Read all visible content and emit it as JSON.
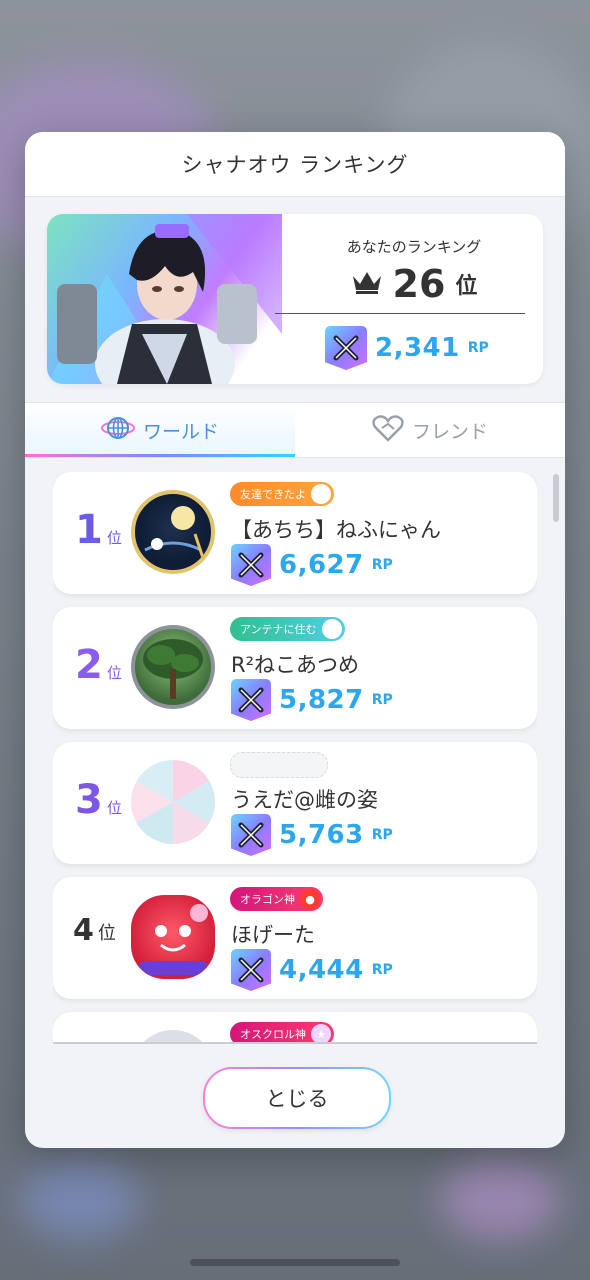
{
  "modal": {
    "title": "シャナオウ ランキング",
    "my_ranking": {
      "label": "あなたのランキング",
      "rank": "26",
      "rank_unit": "位",
      "rp": "2,341",
      "rp_unit": "RP"
    },
    "tabs": [
      {
        "label": "ワールド",
        "icon": "globe-icon",
        "active": true
      },
      {
        "label": "フレンド",
        "icon": "handshake-heart-icon",
        "active": false
      }
    ],
    "close_label": "とじる"
  },
  "entries": [
    {
      "rank": "1",
      "rank_unit": "位",
      "rank_color": "#6c5ce7",
      "title": "友達できたよ",
      "name": "【あちち】ねふにゃん",
      "rp": "6,627",
      "rp_unit": "RP"
    },
    {
      "rank": "2",
      "rank_unit": "位",
      "rank_color": "#8a5cf0",
      "title": "アンテナに住む",
      "name": "R²ねこあつめ",
      "rp": "5,827",
      "rp_unit": "RP"
    },
    {
      "rank": "3",
      "rank_unit": "位",
      "rank_color": "#7d57e8",
      "title": "",
      "name": "うえだ@雌の姿",
      "rp": "5,763",
      "rp_unit": "RP"
    },
    {
      "rank": "4",
      "rank_unit": "位",
      "rank_color": "#333333",
      "title": "オラゴン神",
      "name": "ほげーた",
      "rp": "4,444",
      "rp_unit": "RP"
    },
    {
      "rank": "",
      "rank_unit": "",
      "rank_color": "#333333",
      "title": "オスクロル神",
      "name": "",
      "rp": "",
      "rp_unit": ""
    }
  ],
  "colors": {
    "rp_text": "#2aa7f0",
    "tab_active": "#4a8fe0",
    "tab_inactive": "#9aa0a8"
  }
}
